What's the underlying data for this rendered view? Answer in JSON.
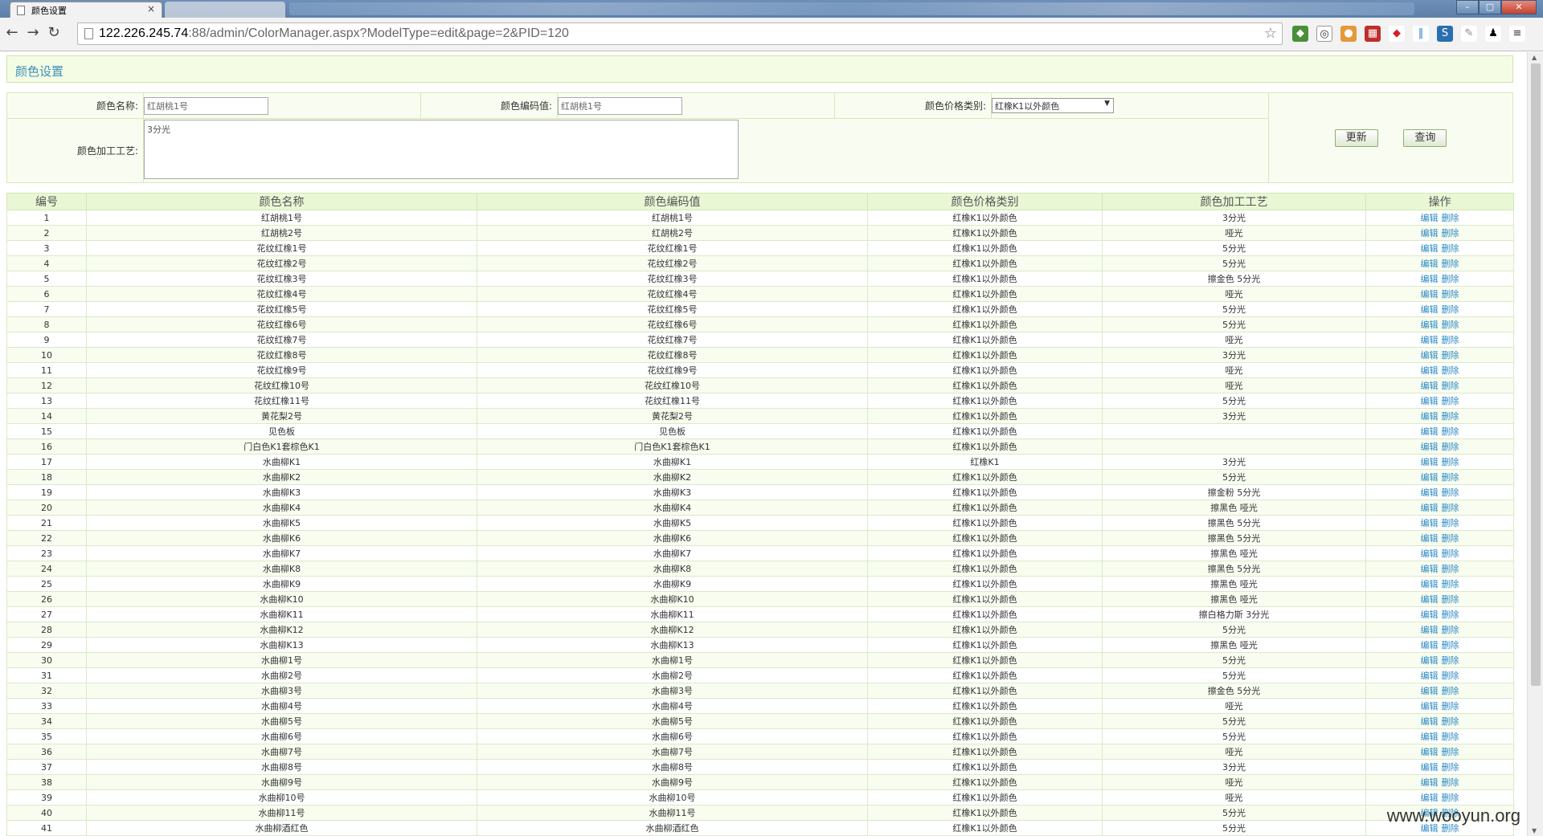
{
  "browser": {
    "active_tab_title": "颜色设置",
    "tab_close": "×",
    "url_host": "122.226.245.74",
    "url_rest": ":88/admin/ColorManager.aspx?ModelType=edit&page=2&PID=120",
    "window_buttons": [
      "–",
      "▢",
      "✕"
    ]
  },
  "page": {
    "title": "颜色设置",
    "watermark": "www.wooyun.org"
  },
  "form": {
    "name_label": "颜色名称:",
    "name_value": "红胡桃1号",
    "code_label": "颜色编码值:",
    "code_value": "红胡桃1号",
    "price_label": "颜色价格类别:",
    "price_value": "红橡K1以外颜色",
    "process_label": "颜色加工工艺:",
    "process_value": "3分光",
    "update_button": "更新",
    "query_button": "查询"
  },
  "table": {
    "headers": [
      "编号",
      "颜色名称",
      "颜色编码值",
      "颜色价格类别",
      "颜色加工工艺",
      "操作"
    ],
    "edit_label": "编辑",
    "delete_label": "删除",
    "rows": [
      [
        "1",
        "红胡桃1号",
        "红胡桃1号",
        "红橡K1以外颜色",
        "3分光"
      ],
      [
        "2",
        "红胡桃2号",
        "红胡桃2号",
        "红橡K1以外颜色",
        "哑光"
      ],
      [
        "3",
        "花纹红橡1号",
        "花纹红橡1号",
        "红橡K1以外颜色",
        "5分光"
      ],
      [
        "4",
        "花纹红橡2号",
        "花纹红橡2号",
        "红橡K1以外颜色",
        "5分光"
      ],
      [
        "5",
        "花纹红橡3号",
        "花纹红橡3号",
        "红橡K1以外颜色",
        "擦金色 5分光"
      ],
      [
        "6",
        "花纹红橡4号",
        "花纹红橡4号",
        "红橡K1以外颜色",
        "哑光"
      ],
      [
        "7",
        "花纹红橡5号",
        "花纹红橡5号",
        "红橡K1以外颜色",
        "5分光"
      ],
      [
        "8",
        "花纹红橡6号",
        "花纹红橡6号",
        "红橡K1以外颜色",
        "5分光"
      ],
      [
        "9",
        "花纹红橡7号",
        "花纹红橡7号",
        "红橡K1以外颜色",
        "哑光"
      ],
      [
        "10",
        "花纹红橡8号",
        "花纹红橡8号",
        "红橡K1以外颜色",
        "3分光"
      ],
      [
        "11",
        "花纹红橡9号",
        "花纹红橡9号",
        "红橡K1以外颜色",
        "哑光"
      ],
      [
        "12",
        "花纹红橡10号",
        "花纹红橡10号",
        "红橡K1以外颜色",
        "哑光"
      ],
      [
        "13",
        "花纹红橡11号",
        "花纹红橡11号",
        "红橡K1以外颜色",
        "5分光"
      ],
      [
        "14",
        "黄花梨2号",
        "黄花梨2号",
        "红橡K1以外颜色",
        "3分光"
      ],
      [
        "15",
        "见色板",
        "见色板",
        "红橡K1以外颜色",
        ""
      ],
      [
        "16",
        "门白色K1套棕色K1",
        "门白色K1套棕色K1",
        "红橡K1以外颜色",
        ""
      ],
      [
        "17",
        "水曲柳K1",
        "水曲柳K1",
        "红橡K1",
        "3分光"
      ],
      [
        "18",
        "水曲柳K2",
        "水曲柳K2",
        "红橡K1以外颜色",
        "5分光"
      ],
      [
        "19",
        "水曲柳K3",
        "水曲柳K3",
        "红橡K1以外颜色",
        "擦金粉 5分光"
      ],
      [
        "20",
        "水曲柳K4",
        "水曲柳K4",
        "红橡K1以外颜色",
        "擦黑色 哑光"
      ],
      [
        "21",
        "水曲柳K5",
        "水曲柳K5",
        "红橡K1以外颜色",
        "擦黑色 5分光"
      ],
      [
        "22",
        "水曲柳K6",
        "水曲柳K6",
        "红橡K1以外颜色",
        "擦黑色 5分光"
      ],
      [
        "23",
        "水曲柳K7",
        "水曲柳K7",
        "红橡K1以外颜色",
        "擦黑色 哑光"
      ],
      [
        "24",
        "水曲柳K8",
        "水曲柳K8",
        "红橡K1以外颜色",
        "擦黑色 5分光"
      ],
      [
        "25",
        "水曲柳K9",
        "水曲柳K9",
        "红橡K1以外颜色",
        "擦黑色 哑光"
      ],
      [
        "26",
        "水曲柳K10",
        "水曲柳K10",
        "红橡K1以外颜色",
        "擦黑色 哑光"
      ],
      [
        "27",
        "水曲柳K11",
        "水曲柳K11",
        "红橡K1以外颜色",
        "擦白格力斯 3分光"
      ],
      [
        "28",
        "水曲柳K12",
        "水曲柳K12",
        "红橡K1以外颜色",
        "5分光"
      ],
      [
        "29",
        "水曲柳K13",
        "水曲柳K13",
        "红橡K1以外颜色",
        "擦黑色 哑光"
      ],
      [
        "30",
        "水曲柳1号",
        "水曲柳1号",
        "红橡K1以外颜色",
        "5分光"
      ],
      [
        "31",
        "水曲柳2号",
        "水曲柳2号",
        "红橡K1以外颜色",
        "5分光"
      ],
      [
        "32",
        "水曲柳3号",
        "水曲柳3号",
        "红橡K1以外颜色",
        "擦金色 5分光"
      ],
      [
        "33",
        "水曲柳4号",
        "水曲柳4号",
        "红橡K1以外颜色",
        "哑光"
      ],
      [
        "34",
        "水曲柳5号",
        "水曲柳5号",
        "红橡K1以外颜色",
        "5分光"
      ],
      [
        "35",
        "水曲柳6号",
        "水曲柳6号",
        "红橡K1以外颜色",
        "5分光"
      ],
      [
        "36",
        "水曲柳7号",
        "水曲柳7号",
        "红橡K1以外颜色",
        "哑光"
      ],
      [
        "37",
        "水曲柳8号",
        "水曲柳8号",
        "红橡K1以外颜色",
        "3分光"
      ],
      [
        "38",
        "水曲柳9号",
        "水曲柳9号",
        "红橡K1以外颜色",
        "哑光"
      ],
      [
        "39",
        "水曲柳10号",
        "水曲柳10号",
        "红橡K1以外颜色",
        "哑光"
      ],
      [
        "40",
        "水曲柳11号",
        "水曲柳11号",
        "红橡K1以外颜色",
        "5分光"
      ],
      [
        "41",
        "水曲柳酒红色",
        "水曲柳酒红色",
        "红橡K1以外颜色",
        "5分光"
      ]
    ]
  },
  "colors": {
    "link": "#2b8ac5",
    "title_text": "#3f8fb8",
    "header_bg": "#e9f7d5"
  }
}
